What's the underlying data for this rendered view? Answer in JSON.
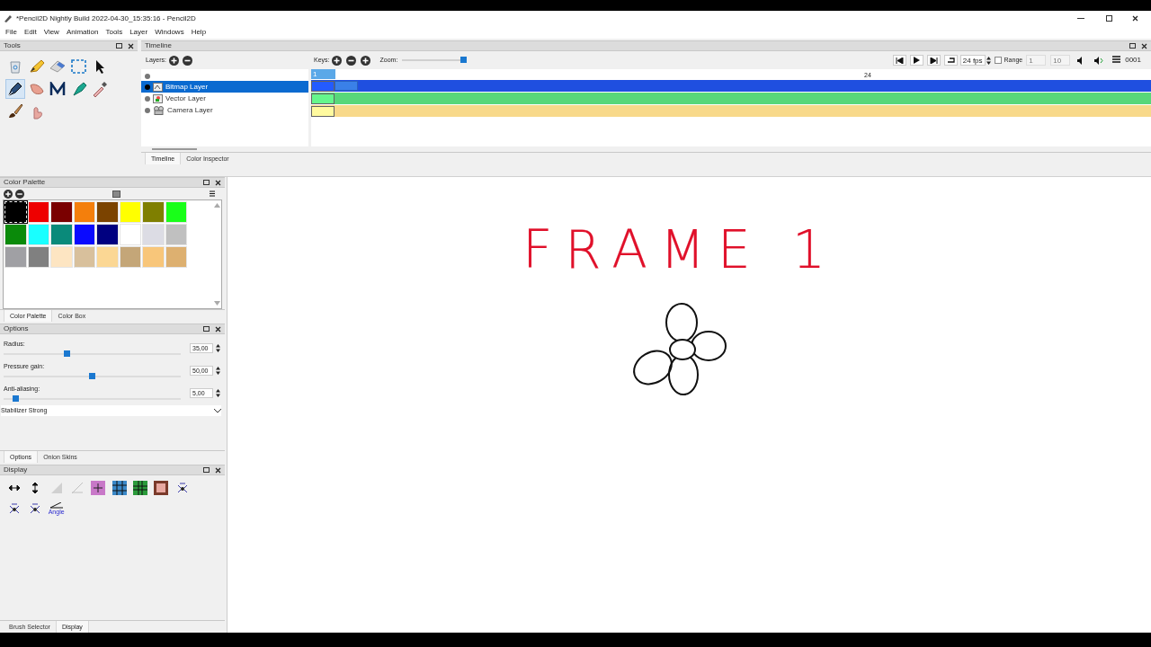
{
  "window": {
    "title": "*Pencil2D Nightly Build 2022-04-30_15:35:16 - Pencil2D"
  },
  "menu": [
    "File",
    "Edit",
    "View",
    "Animation",
    "Tools",
    "Layer",
    "Windows",
    "Help"
  ],
  "tools_panel": {
    "title": "Tools",
    "tools": [
      {
        "kind": "clear",
        "selected": false
      },
      {
        "kind": "pencil",
        "selected": false
      },
      {
        "kind": "eraser",
        "selected": false
      },
      {
        "kind": "select",
        "selected": false
      },
      {
        "kind": "move",
        "selected": false
      },
      {
        "kind": "pen",
        "selected": true
      },
      {
        "kind": "smudge",
        "selected": false
      },
      {
        "kind": "polyline",
        "selected": false
      },
      {
        "kind": "bucket",
        "selected": false
      },
      {
        "kind": "eyedropper",
        "selected": false
      },
      {
        "kind": "brush",
        "selected": false
      },
      {
        "kind": "hand",
        "selected": false
      }
    ]
  },
  "timeline": {
    "title": "Timeline",
    "layers_label": "Layers:",
    "keys_label": "Keys:",
    "zoom_label": "Zoom:",
    "zoom": {
      "level": 1.0
    },
    "layers": [
      {
        "name": "Bitmap Layer",
        "kind": "bitmap",
        "selected": true,
        "color": "#1f4fe0"
      },
      {
        "name": "Vector Layer",
        "kind": "vector",
        "selected": false,
        "color": "#58d77a"
      },
      {
        "name": "Camera Layer",
        "kind": "camera",
        "selected": false,
        "color": "#f8d98a"
      }
    ],
    "ruler": {
      "first": "1",
      "marker": "24"
    },
    "fps": "24 fps",
    "range": {
      "label": "Range",
      "checked": false,
      "start": "1",
      "end": "10"
    },
    "frame": "0001",
    "tabs": [
      {
        "label": "Timeline",
        "selected": true
      },
      {
        "label": "Color Inspector",
        "selected": false
      }
    ]
  },
  "color_palette": {
    "title": "Color Palette",
    "swatches": [
      {
        "color": "#000000",
        "selected": true
      },
      {
        "color": "#ee0000",
        "selected": false
      },
      {
        "color": "#7a0000",
        "selected": false
      },
      {
        "color": "#f47f0c",
        "selected": false
      },
      {
        "color": "#7b4300",
        "selected": false
      },
      {
        "color": "#ffff00",
        "selected": false
      },
      {
        "color": "#7f7f00",
        "selected": false
      },
      {
        "color": "#19ff19",
        "selected": false
      },
      {
        "color": "#0a8a0a",
        "selected": false
      },
      {
        "color": "#19ffff",
        "selected": false
      },
      {
        "color": "#0a8a7a",
        "selected": false
      },
      {
        "color": "#0a0aff",
        "selected": false
      },
      {
        "color": "#000080",
        "selected": false
      },
      {
        "color": "#ffffff",
        "selected": false
      },
      {
        "color": "#dcdce4",
        "selected": false
      },
      {
        "color": "#c0c0c0",
        "selected": false
      },
      {
        "color": "#a0a0a4",
        "selected": false
      },
      {
        "color": "#808080",
        "selected": false
      },
      {
        "color": "#fde5c2",
        "selected": false
      },
      {
        "color": "#d8c09c",
        "selected": false
      },
      {
        "color": "#fbd794",
        "selected": false
      },
      {
        "color": "#c4a678",
        "selected": false
      },
      {
        "color": "#f8c67a",
        "selected": false
      },
      {
        "color": "#ddb070",
        "selected": false
      }
    ],
    "tabs": [
      {
        "label": "Color Palette",
        "selected": true
      },
      {
        "label": "Color Box",
        "selected": false
      }
    ]
  },
  "options": {
    "title": "Options",
    "sliders": [
      {
        "label": "Radius:",
        "level": 0.35,
        "value": "35,00"
      },
      {
        "label": "Pressure gain:",
        "level": 0.5,
        "value": "50,00"
      },
      {
        "label": "Anti-aliasing:",
        "level": 0.05,
        "value": "5,00"
      }
    ],
    "stabilizer": {
      "label": "Stabilizer",
      "value": "Strong"
    },
    "tabs": [
      {
        "label": "Options",
        "selected": true
      },
      {
        "label": "Onion Skins",
        "selected": false
      }
    ]
  },
  "display": {
    "title": "Display",
    "buttons": [
      {
        "kind": "flip-h",
        "disabled": false
      },
      {
        "kind": "flip-v",
        "disabled": false
      },
      {
        "kind": "overlay",
        "disabled": true
      },
      {
        "kind": "angle-line",
        "disabled": true
      },
      {
        "kind": "center",
        "disabled": false
      },
      {
        "kind": "thirds",
        "disabled": false
      },
      {
        "kind": "golden",
        "disabled": false
      },
      {
        "kind": "safe",
        "disabled": false
      },
      {
        "kind": "onion",
        "disabled": false
      },
      {
        "kind": "onion",
        "disabled": false
      },
      {
        "kind": "onion",
        "disabled": false
      },
      {
        "kind": "angle",
        "disabled": false,
        "label": "Angle"
      }
    ],
    "tabs": [
      {
        "label": "Brush Selector",
        "selected": false
      },
      {
        "label": "Display",
        "selected": true
      }
    ]
  },
  "canvas": {
    "text": "FRAME 1"
  }
}
